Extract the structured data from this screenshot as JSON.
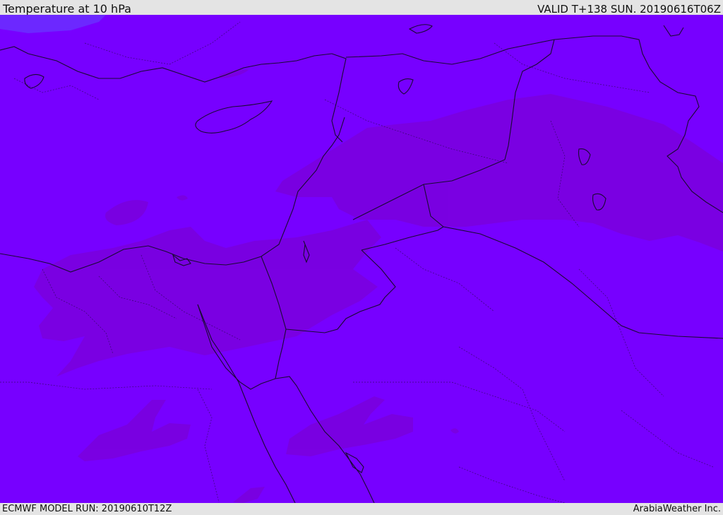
{
  "header": {
    "title": "Temperature at 10 hPa",
    "valid_time": "VALID T+138 SUN. 20190616T06Z"
  },
  "footer": {
    "model_run": "ECMWF MODEL RUN: 20190610T12Z",
    "credit": "ArabiaWeather Inc."
  },
  "map": {
    "field_colors": {
      "base": "#7700ff",
      "warmer_band": "#7a00e0",
      "cooler_patch": "#6a2cff"
    },
    "border_color": "#1a0a33"
  }
}
